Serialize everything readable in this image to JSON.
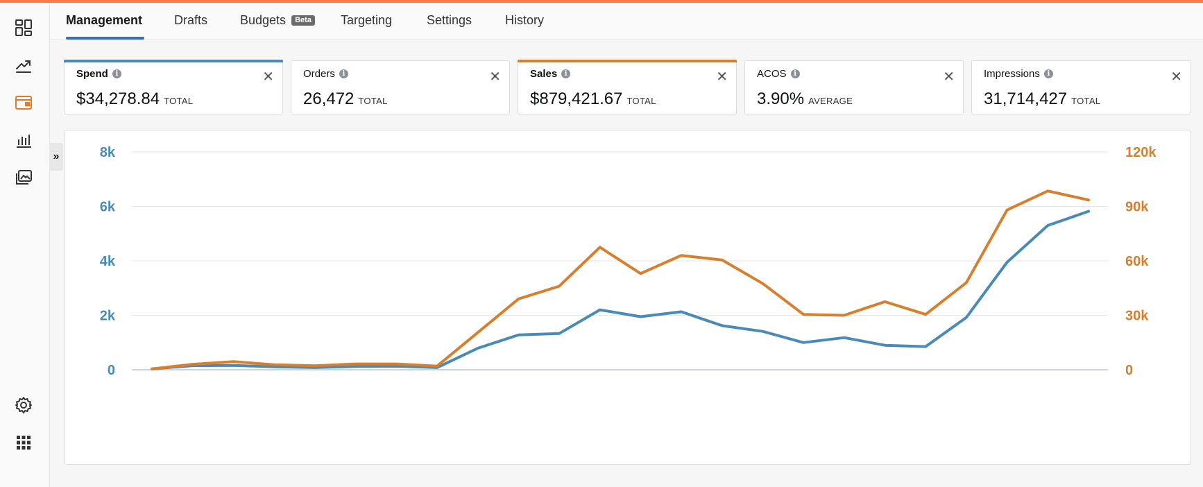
{
  "tabs": [
    {
      "label": "Management",
      "active": true
    },
    {
      "label": "Drafts"
    },
    {
      "label": "Budgets",
      "badge": "Beta"
    },
    {
      "label": "Targeting"
    },
    {
      "label": "Settings"
    },
    {
      "label": "History"
    }
  ],
  "sidebar": {
    "icons": [
      "dashboard-icon",
      "trend-icon",
      "campaign-icon",
      "bar-chart-icon",
      "media-icon",
      "settings-icon",
      "apps-grid-icon"
    ],
    "collapse_label": "»"
  },
  "metrics": [
    {
      "title": "Spend",
      "value": "$34,278.84",
      "suffix": "TOTAL",
      "selected": true,
      "color": "#4a8ab6"
    },
    {
      "title": "Orders",
      "value": "26,472",
      "suffix": "TOTAL",
      "selected": false
    },
    {
      "title": "Sales",
      "value": "$879,421.67",
      "suffix": "TOTAL",
      "selected": true,
      "color": "#d67f2e"
    },
    {
      "title": "ACOS",
      "value": "3.90%",
      "suffix": "AVERAGE",
      "selected": false
    },
    {
      "title": "Impressions",
      "value": "31,714,427",
      "suffix": "TOTAL",
      "selected": false
    }
  ],
  "colors": {
    "spend": "#4a8ab6",
    "sales": "#d67f2e",
    "accent_top": "#ff7a45",
    "active_tab": "#2f73b5"
  },
  "chart_data": {
    "type": "line",
    "grid": true,
    "left_axis": {
      "ticks": [
        "0",
        "2k",
        "4k",
        "6k",
        "8k"
      ],
      "range": [
        0,
        8000
      ],
      "color": "#4a8ab6"
    },
    "right_axis": {
      "ticks": [
        "0",
        "30k",
        "60k",
        "90k",
        "120k"
      ],
      "range": [
        0,
        120000
      ],
      "color": "#d67f2e"
    },
    "series": [
      {
        "axis": "left",
        "color": "#4a8ab6",
        "values": [
          30,
          150,
          160,
          110,
          80,
          120,
          130,
          80,
          790,
          1280,
          1330,
          2200,
          1950,
          2130,
          1620,
          1410,
          1000,
          1180,
          900,
          850,
          1920,
          3950,
          5300,
          5820
        ]
      },
      {
        "axis": "right",
        "color": "#d67f2e",
        "values": [
          500,
          3000,
          4500,
          2800,
          2200,
          3200,
          3200,
          2000,
          20500,
          39000,
          46000,
          67500,
          53000,
          63000,
          60500,
          47500,
          30500,
          30000,
          37500,
          30500,
          48000,
          88000,
          98500,
          93500
        ]
      }
    ]
  }
}
